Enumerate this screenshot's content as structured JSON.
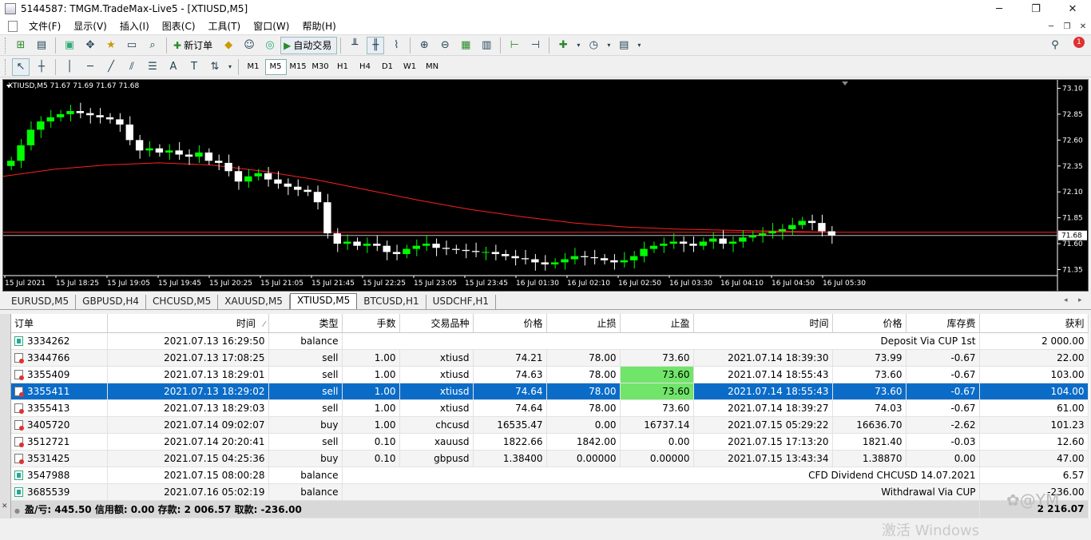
{
  "window": {
    "title": "5144587: TMGM.TradeMax-Live5 - [XTIUSD,M5]",
    "minimize": "─",
    "restore": "❐",
    "close": "✕"
  },
  "menu": [
    "文件(F)",
    "显示(V)",
    "插入(I)",
    "图表(C)",
    "工具(T)",
    "窗口(W)",
    "帮助(H)"
  ],
  "toolbar": {
    "new_order_label": "新订单",
    "autotrade_label": "自动交易",
    "timeframes": [
      "M1",
      "M5",
      "M15",
      "M30",
      "H1",
      "H4",
      "D1",
      "W1",
      "MN"
    ],
    "active_timeframe": "M5",
    "notification_count": "1"
  },
  "chart": {
    "header": "XTIUSD,M5  71.67 71.69 71.67 71.68",
    "price_labels": [
      "73.10",
      "72.85",
      "72.60",
      "72.35",
      "72.10",
      "71.85",
      "71.60",
      "71.35"
    ],
    "current_price": "71.68",
    "time_labels": [
      "15 Jul 2021",
      "15 Jul 18:25",
      "15 Jul 19:05",
      "15 Jul 19:45",
      "15 Jul 20:25",
      "15 Jul 21:05",
      "15 Jul 21:45",
      "15 Jul 22:25",
      "15 Jul 23:05",
      "15 Jul 23:45",
      "16 Jul 01:30",
      "16 Jul 02:10",
      "16 Jul 02:50",
      "16 Jul 03:30",
      "16 Jul 04:10",
      "16 Jul 04:50",
      "16 Jul 05:30"
    ],
    "colors": {
      "background": "#000000",
      "bull": "#00ff00",
      "bear": "#ffffff",
      "ma": "#ff2020",
      "grid_text": "#ffffff"
    }
  },
  "chart_data": {
    "type": "candlestick",
    "symbol": "XTIUSD",
    "timeframe": "M5",
    "ylim": [
      71.3,
      73.15
    ],
    "close_series": [
      72.4,
      72.55,
      72.7,
      72.78,
      72.82,
      72.85,
      72.88,
      72.86,
      72.84,
      72.82,
      72.8,
      72.75,
      72.6,
      72.5,
      72.52,
      72.48,
      72.5,
      72.46,
      72.44,
      72.48,
      72.4,
      72.38,
      72.3,
      72.2,
      72.25,
      72.28,
      72.22,
      72.18,
      72.15,
      72.12,
      72.1,
      72.0,
      71.7,
      71.6,
      71.62,
      71.58,
      71.6,
      71.58,
      71.52,
      71.5,
      71.55,
      71.58,
      71.6,
      71.56,
      71.55,
      71.54,
      71.53,
      71.52,
      71.52,
      71.5,
      71.48,
      71.46,
      71.45,
      71.42,
      71.4,
      71.42,
      71.45,
      71.48,
      71.47,
      71.46,
      71.44,
      71.42,
      71.44,
      71.48,
      71.55,
      71.58,
      71.6,
      71.62,
      71.6,
      71.58,
      71.62,
      71.65,
      71.6,
      71.62,
      71.66,
      71.68,
      71.7,
      71.72,
      71.74,
      71.78,
      71.82,
      71.8,
      71.72,
      71.68
    ],
    "ma_series": [
      72.25,
      72.32,
      72.36,
      72.38,
      72.36,
      72.3,
      72.22,
      72.12,
      72.02,
      71.93,
      71.86,
      71.8,
      71.76,
      71.74,
      71.73,
      71.72,
      71.71
    ],
    "current_price": 71.68
  },
  "tabs": [
    "EURUSD,M5",
    "GBPUSD,H4",
    "CHCUSD,M5",
    "XAUUSD,M5",
    "XTIUSD,M5",
    "BTCUSD,H1",
    "USDCHF,H1"
  ],
  "active_tab": "XTIUSD,M5",
  "history": {
    "columns": [
      "订单",
      "时间",
      "类型",
      "手数",
      "交易品种",
      "价格",
      "止损",
      "止盈",
      "时间",
      "价格",
      "库存费",
      "获利"
    ],
    "rows": [
      {
        "id": "3334262",
        "time": "2021.07.13 16:29:50",
        "type": "balance",
        "comment": "Deposit Via CUP 1st",
        "profit": "2 000.00"
      },
      {
        "id": "3344766",
        "time": "2021.07.13 17:08:25",
        "type": "sell",
        "lots": "1.00",
        "symbol": "xtiusd",
        "price": "74.21",
        "sl": "78.00",
        "tp": "73.60",
        "ctime": "2021.07.14 18:39:30",
        "cprice": "73.99",
        "swap": "-0.67",
        "profit": "22.00"
      },
      {
        "id": "3355409",
        "time": "2021.07.13 18:29:01",
        "type": "sell",
        "lots": "1.00",
        "symbol": "xtiusd",
        "price": "74.63",
        "sl": "78.00",
        "tp": "73.60",
        "ctime": "2021.07.14 18:55:43",
        "cprice": "73.60",
        "swap": "-0.67",
        "profit": "103.00",
        "tp_hit": true
      },
      {
        "id": "3355411",
        "time": "2021.07.13 18:29:02",
        "type": "sell",
        "lots": "1.00",
        "symbol": "xtiusd",
        "price": "74.64",
        "sl": "78.00",
        "tp": "73.60",
        "ctime": "2021.07.14 18:55:43",
        "cprice": "73.60",
        "swap": "-0.67",
        "profit": "104.00",
        "tp_hit": true,
        "selected": true
      },
      {
        "id": "3355413",
        "time": "2021.07.13 18:29:03",
        "type": "sell",
        "lots": "1.00",
        "symbol": "xtiusd",
        "price": "74.64",
        "sl": "78.00",
        "tp": "73.60",
        "ctime": "2021.07.14 18:39:27",
        "cprice": "74.03",
        "swap": "-0.67",
        "profit": "61.00"
      },
      {
        "id": "3405720",
        "time": "2021.07.14 09:02:07",
        "type": "buy",
        "lots": "1.00",
        "symbol": "chcusd",
        "price": "16535.47",
        "sl": "0.00",
        "tp": "16737.14",
        "ctime": "2021.07.15 05:29:22",
        "cprice": "16636.70",
        "swap": "-2.62",
        "profit": "101.23"
      },
      {
        "id": "3512721",
        "time": "2021.07.14 20:20:41",
        "type": "sell",
        "lots": "0.10",
        "symbol": "xauusd",
        "price": "1822.66",
        "sl": "1842.00",
        "tp": "0.00",
        "ctime": "2021.07.15 17:13:20",
        "cprice": "1821.40",
        "swap": "-0.03",
        "profit": "12.60"
      },
      {
        "id": "3531425",
        "time": "2021.07.15 04:25:36",
        "type": "buy",
        "lots": "0.10",
        "symbol": "gbpusd",
        "price": "1.38400",
        "sl": "0.00000",
        "tp": "0.00000",
        "ctime": "2021.07.15 13:43:34",
        "cprice": "1.38870",
        "swap": "0.00",
        "profit": "47.00"
      },
      {
        "id": "3547988",
        "time": "2021.07.15 08:00:28",
        "type": "balance",
        "comment": "CFD Dividend CHCUSD 14.07.2021",
        "profit": "6.57"
      },
      {
        "id": "3685539",
        "time": "2021.07.16 05:02:19",
        "type": "balance",
        "comment": "Withdrawal Via CUP",
        "profit": "-236.00"
      }
    ],
    "summary": "盈/亏: 445.50  信用额: 0.00  存款: 2 006.57  取款: -236.00",
    "summary_total": "2 216.07"
  },
  "watermark": "激活 Windows"
}
